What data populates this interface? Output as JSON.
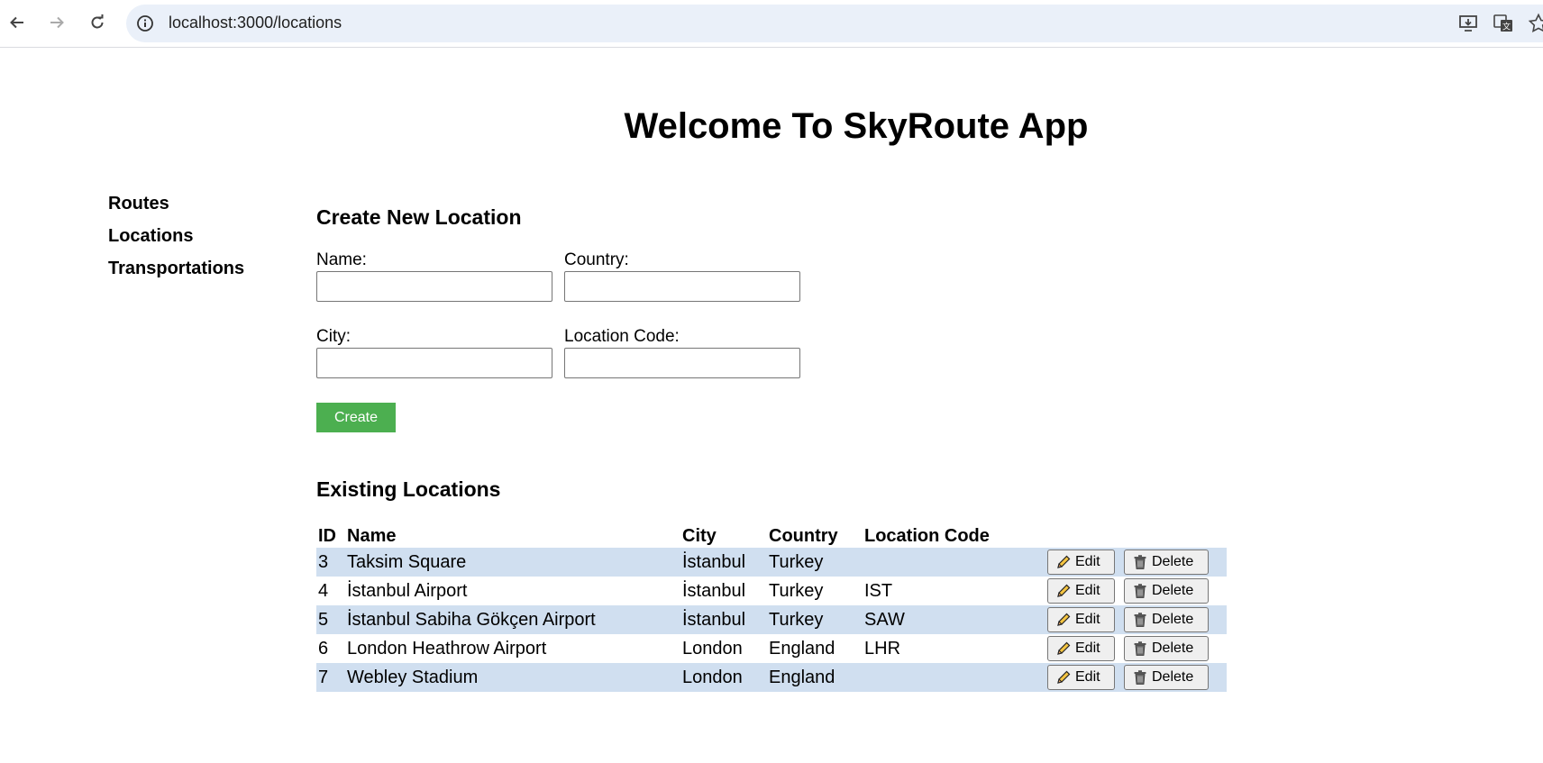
{
  "browser": {
    "url": "localhost:3000/locations"
  },
  "page": {
    "title": "Welcome To SkyRoute App"
  },
  "sidebar": {
    "items": [
      {
        "label": "Routes"
      },
      {
        "label": "Locations"
      },
      {
        "label": "Transportations"
      }
    ]
  },
  "form": {
    "heading": "Create New Location",
    "name_label": "Name:",
    "name_value": "",
    "country_label": "Country:",
    "country_value": "",
    "city_label": "City:",
    "city_value": "",
    "code_label": "Location Code:",
    "code_value": "",
    "create_label": "Create",
    "create_color": "#4caf50"
  },
  "list": {
    "heading": "Existing Locations",
    "columns": [
      "ID",
      "Name",
      "City",
      "Country",
      "Location Code"
    ],
    "edit_label": "Edit",
    "delete_label": "Delete",
    "rows": [
      {
        "id": "3",
        "name": "Taksim Square",
        "city": "İstanbul",
        "country": "Turkey",
        "code": ""
      },
      {
        "id": "4",
        "name": "İstanbul Airport",
        "city": "İstanbul",
        "country": "Turkey",
        "code": "IST"
      },
      {
        "id": "5",
        "name": "İstanbul Sabiha Gökçen Airport",
        "city": "İstanbul",
        "country": "Turkey",
        "code": "SAW"
      },
      {
        "id": "6",
        "name": "London Heathrow Airport",
        "city": "London",
        "country": "England",
        "code": "LHR"
      },
      {
        "id": "7",
        "name": "Webley Stadium",
        "city": "London",
        "country": "England",
        "code": ""
      }
    ],
    "row_stripe_color": "#d0dff0"
  }
}
